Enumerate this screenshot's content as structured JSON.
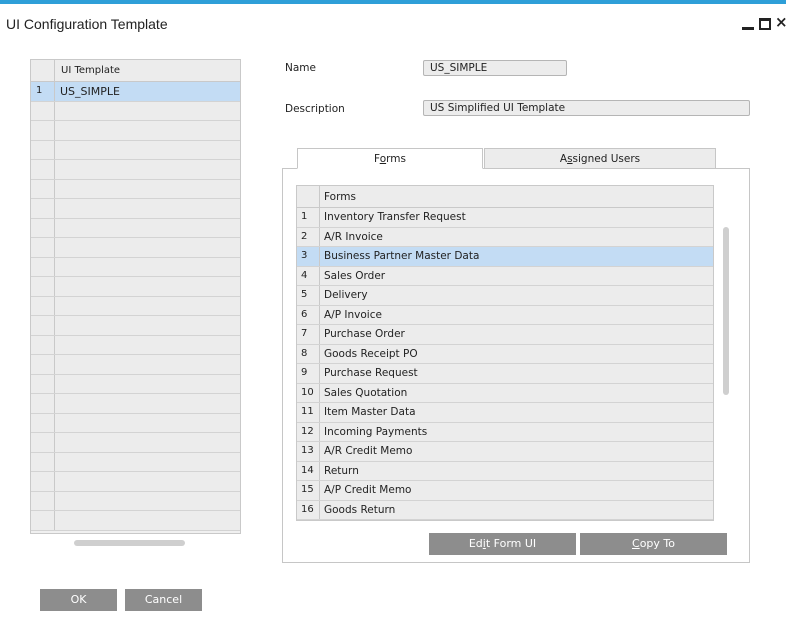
{
  "window": {
    "title": "UI Configuration Template",
    "controls": {
      "minimize_icon": "minimize-icon",
      "maximize_icon": "maximize-icon",
      "close_icon": "close-icon",
      "close_glyph": "×"
    }
  },
  "template_list": {
    "header": "UI Template",
    "rows": [
      {
        "num": "1",
        "name": "US_SIMPLE",
        "selected": true
      }
    ]
  },
  "details": {
    "name_label": "Name",
    "name_value": "US_SIMPLE",
    "description_label": "Description",
    "description_value": "US Simplified UI Template"
  },
  "tabs": {
    "forms": {
      "pre": "F",
      "ul": "o",
      "post": "rms"
    },
    "assigned_users": {
      "pre": "A",
      "ul": "s",
      "post": "signed Users"
    }
  },
  "forms_grid": {
    "header": "Forms",
    "selected_index": 3,
    "rows": [
      {
        "num": "1",
        "name": "Inventory Transfer Request"
      },
      {
        "num": "2",
        "name": "A/R Invoice"
      },
      {
        "num": "3",
        "name": "Business Partner Master Data"
      },
      {
        "num": "4",
        "name": "Sales Order"
      },
      {
        "num": "5",
        "name": "Delivery"
      },
      {
        "num": "6",
        "name": "A/P Invoice"
      },
      {
        "num": "7",
        "name": "Purchase Order"
      },
      {
        "num": "8",
        "name": "Goods Receipt PO"
      },
      {
        "num": "9",
        "name": "Purchase Request"
      },
      {
        "num": "10",
        "name": "Sales Quotation"
      },
      {
        "num": "11",
        "name": "Item Master Data"
      },
      {
        "num": "12",
        "name": "Incoming Payments"
      },
      {
        "num": "13",
        "name": "A/R Credit Memo"
      },
      {
        "num": "14",
        "name": "Return"
      },
      {
        "num": "15",
        "name": "A/P Credit Memo"
      },
      {
        "num": "16",
        "name": "Goods Return"
      }
    ]
  },
  "buttons": {
    "edit_form_ui": {
      "pre": "Ed",
      "ul": "i",
      "post": "t Form UI"
    },
    "copy_to": {
      "pre": "",
      "ul": "C",
      "post": "opy To"
    },
    "ok": "OK",
    "cancel": "Cancel"
  },
  "colors": {
    "accent_bar": "#2e9fd8",
    "selected_row": "#c3dcf4",
    "button_bg": "#8d8d8d"
  }
}
